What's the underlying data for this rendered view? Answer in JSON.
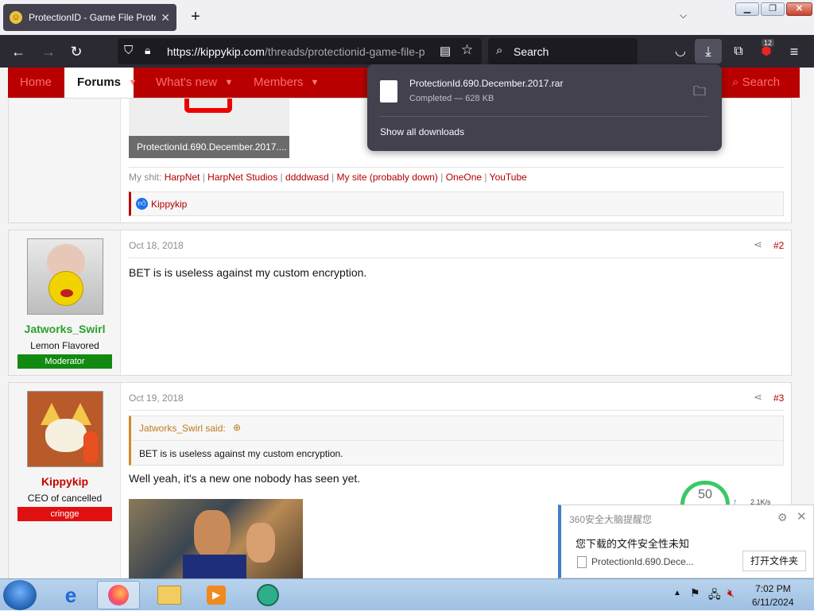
{
  "browser": {
    "tab_title": "ProtectionID - Game File Protec",
    "url_host": "https://kippykip.com",
    "url_path": "/threads/protectionid-game-file-p",
    "search_placeholder": "Search",
    "extension_badge": "12"
  },
  "site_nav": {
    "home": "Home",
    "forums": "Forums",
    "whats_new": "What's new",
    "members": "Members",
    "search": "Search"
  },
  "downloads_panel": {
    "file_name": "ProtectionId.690.December.2017.rar",
    "status": "Completed — 628 KB",
    "show_all": "Show all downloads"
  },
  "post1": {
    "attachment_caption": "ProtectionId.690.December.2017....",
    "signature_prefix": "My shit:",
    "signature_links": [
      "HarpNet",
      "HarpNet Studios",
      "ddddwasd",
      "My site (probably down)",
      "OneOne",
      "YouTube"
    ],
    "reaction_user": "Kippykip"
  },
  "post2": {
    "username": "Jatworks_Swirl",
    "user_title": "Lemon Flavored",
    "banner": "Moderator",
    "date": "Oct 18, 2018",
    "number": "#2",
    "body": "BET is is useless against my custom encryption.",
    "colors": {
      "username": "#2aa12a",
      "banner": "#128a12"
    }
  },
  "post3": {
    "username": "Kippykip",
    "user_title": "CEO of cancelled",
    "banner": "cringge",
    "date": "Oct 19, 2018",
    "number": "#3",
    "quote_author": "Jatworks_Swirl said:",
    "quote_body": "BET is is useless against my custom encryption.",
    "body": "Well yeah, it's a new one nobody has seen yet.",
    "colors": {
      "username": "#c80000",
      "banner": "#e01010"
    }
  },
  "popup_360": {
    "title": "360安全大脑提醒您",
    "message": "您下载的文件安全性未知",
    "file_name": "ProtectionId.690.Dece...",
    "button": "打开文件夹",
    "speed": "2.1K/s",
    "gauge": "50"
  },
  "taskbar": {
    "time": "7:02 PM",
    "date": "6/11/2024"
  },
  "colors": {
    "accent": "#b80000",
    "browser_dark": "#2b2a33",
    "panel": "#42414d"
  }
}
